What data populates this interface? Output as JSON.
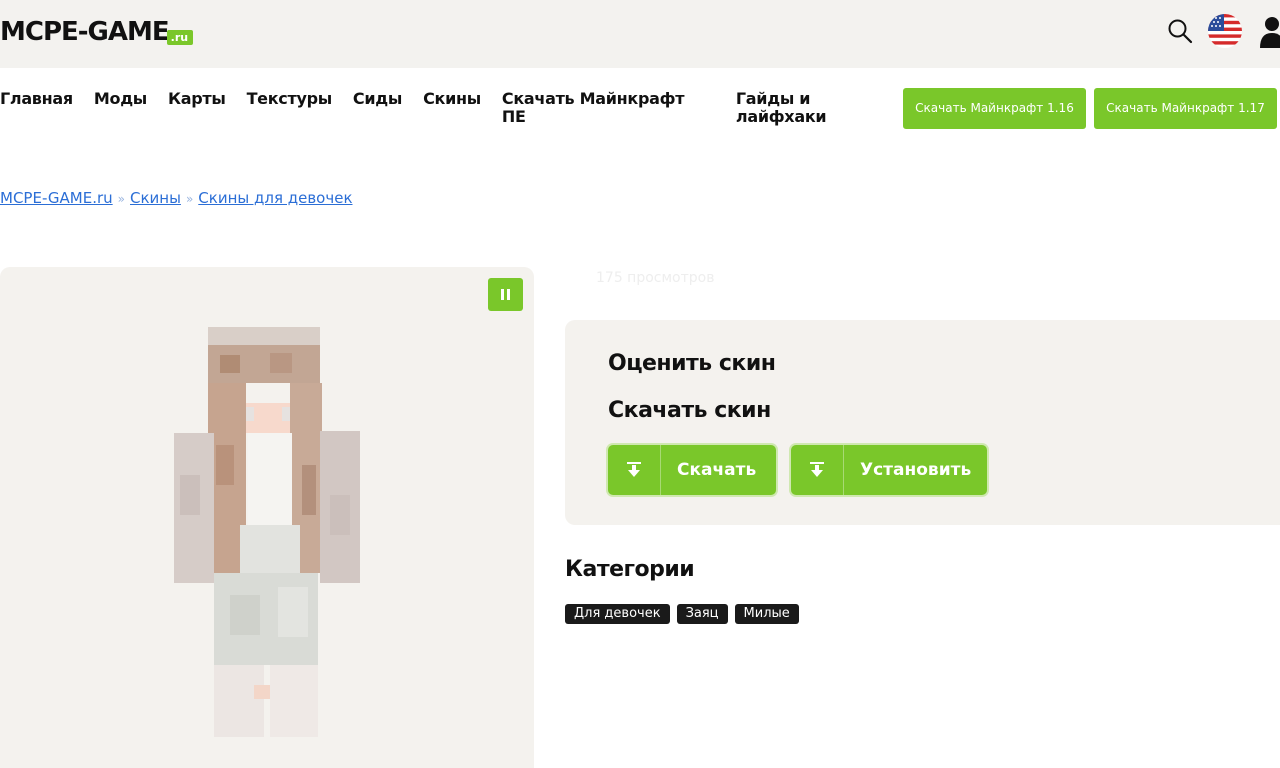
{
  "header": {
    "logo_main": "MCPE-GAME",
    "logo_suffix": ".ru"
  },
  "nav": {
    "items": [
      "Главная",
      "Моды",
      "Карты",
      "Текстуры",
      "Сиды",
      "Скины",
      "Скачать Майнкрафт ПЕ",
      "Гайды и лайфхаки"
    ],
    "cta": [
      "Скачать Майнкрафт 1.16",
      "Скачать Майнкрафт 1.17"
    ]
  },
  "breadcrumb": {
    "items": [
      "MCPE-GAME.ru",
      "Скины",
      "Скины для девочек"
    ],
    "separator": "»"
  },
  "skin": {
    "views": "175 просмотров"
  },
  "rating": {
    "rate_title": "Оценить скин",
    "download_title": "Скачать скин",
    "download_label": "Скачать",
    "install_label": "Установить"
  },
  "categories": {
    "title": "Категории",
    "tags": [
      "Для девочек",
      "Заяц",
      "Милые"
    ]
  },
  "colors": {
    "accent_green": "#7ac72a",
    "link_blue": "#2b6ed6",
    "panel_bg": "#f4f2ee",
    "tag_bg": "#1a1a1a"
  }
}
